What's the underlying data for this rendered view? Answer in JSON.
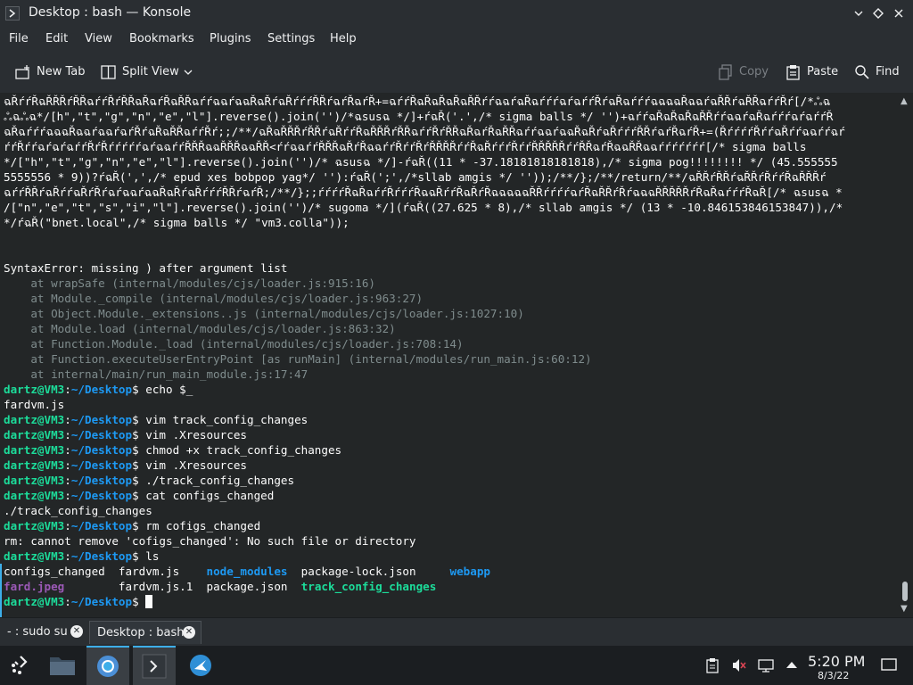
{
  "window": {
    "title": "Desktop : bash — Konsole"
  },
  "menu": [
    "File",
    "Edit",
    "View",
    "Bookmarks",
    "Plugins",
    "Settings",
    "Help"
  ],
  "toolbar": {
    "new_tab": "New Tab",
    "split_view": "Split View",
    "copy": "Copy",
    "paste": "Paste",
    "find": "Find"
  },
  "terminal": {
    "user": "dartz@VM3",
    "path": "~/Desktop",
    "lines": [
      "ฉŘŕŕŘฉŘŘŘŕŘŘฉŕŕŘŕŘŘฉŘฉŕŘฉŘŘฉŕŕฉฉŕฉฉŘฉŘŕฉŘŕŕŕŘŘŕฉŕŘฉŕŘ+=ฉŕŕŘฉŘฉŘฉŘฉŘŘŕŕฉฉŕฉŘฉŕŕŕฉŕฉŕŕŘŕฉŘฉŕŕŕฉฉฉฉŘฉฉŕฉŘŘŕฉŘŘฉŕŕŘŕ[/*ஃฉ",
      "ஃฉஃฉ*/[h\",\"t\",\"g\",\"n\",\"e\",\"l\"].reverse().join('')/*ฉsusฉ */]+ŕฉŘ('.',/* sigma balls */ '')+ฉŕŕฉŘฉŘฉŘฉŘŘŕŕฉฉŕฉŘฉŕŕŕฉŕฉŕŕŘ",
      "ฉŘฉŕŕŕฉฉฉŘฉฉŕฉฉŕฉŕŘŕฉŘฉŘŘฉŕŕŘŕ;;/**/ฉŘฉŘŘŘŕŘŘŕฉŘŕŕŘฉŘŘŘŕŘŘฉŕŕŘŕŘŘฉŘฉŕŘฉŘŘฉŕŕฉฉŕฉฉŘฉŘŕฉŘŕŕŕŘŘŕฉŕŘฉŕŘ+=(ŘŕŕŕŕŘŕŕฉŘŕŕฉฉŕŕฉŕ",
      "ŕŕŘŕŕฉŕฉŕฉŕŕŘŕŘŕŕŕŕŕฉŕฉฉŕŕŘŘŘฉฉŘŘŘฉฉŘŘ<ŕŕฉฉŕŕŘŘŘฉŘŕŘฉฉŕŕŘŕŕŘŕŘŘŘŘŕŕŘฉŘŕŕŕŘŕŕŘŘŘŘŘŕŕŘŘฉŕŘฉฉŘŘฉฉŕŕŕŕŕŕŕ[/* sigma balls",
      "*/[\"h\",\"t\",\"g\",\"n\",\"e\",\"l\"].reverse().join('')/* ฉsusฉ */]-ŕฉŘ((11 * -37.18181818181818),/* sigma pog!!!!!!!! */ (45.555555",
      "5555556 * 9))?ŕฉŘ(',',/* epud xes bobpop yag*/ ''):ŕฉŘ(';',/*sllab amgis */ ''));/**/};/**/return/**/ฉŘŘŕŘŘŕฉŘŘŕŘŕŕŘฉŘŘŘŕ",
      "ฉŕŕŘŘŕฉŘŕŕฉŘŕŘŕฉŕฉฉŕฉฉŘฉŘŕฉŘŕŕŕŘŘŕฉŕŘ;/**/};;ŕŕŕŕŘฉŘฉŕŕŘŕŕŕŘฉฉŘŕŕŘฉŘŕŘฉฉฉฉฉŘŘŕŕŕŕฉŕŘฉŘŘŕŘŕฉฉฉŘŘŘŘŘŕŘฉŘฉŕŕŕŘฉŘ[/* ฉsusฉ *",
      "/[\"n\",\"e\",\"t\",\"s\",\"i\",\"l\"].reverse().join('')/* sugoma */](ŕฉŘ((27.625 * 8),/* sllab amgis */ (13 * -10.846153846153847)),/*",
      "*/ŕฉŘ(\"bnet.local\",/* sigma balls */ \"vm3.colla\"));",
      "",
      "",
      "SyntaxError: missing ) after argument list",
      "    at wrapSafe (internal/modules/cjs/loader.js:915:16)",
      "    at Module._compile (internal/modules/cjs/loader.js:963:27)",
      "    at Object.Module._extensions..js (internal/modules/cjs/loader.js:1027:10)",
      "    at Module.load (internal/modules/cjs/loader.js:863:32)",
      "    at Function.Module._load (internal/modules/cjs/loader.js:708:14)",
      "    at Function.executeUserEntryPoint [as runMain] (internal/modules/run_main.js:60:12)",
      "    at internal/main/run_main_module.js:17:47",
      "$ echo $_",
      "fardvm.js",
      "$ vim track_config_changes",
      "$ vim .Xresources",
      "$ chmod +x track_config_changes",
      "$ vim .Xresources",
      "$ ./track_config_changes",
      "$ cat configs_changed",
      "./track_config_changes",
      "$ rm cofigs_changed",
      "rm: cannot remove 'cofigs_changed': No such file or directory",
      "$ ls",
      "configs_changed  fardvm.js    node_modules  package-lock.json     webapp",
      "fard.jpeg        fardvm.js.1  package.json  track_config_changes",
      "$ "
    ]
  },
  "tabs": [
    {
      "label": "- : sudo su"
    },
    {
      "label": "Desktop : bash"
    }
  ],
  "taskbar": {
    "apps": [
      "app-launcher-icon",
      "file-manager-icon",
      "chromium-icon",
      "konsole-icon",
      "remmina-icon"
    ]
  },
  "clock": {
    "time": "5:20 PM",
    "date": "8/3/22"
  },
  "colors": {
    "accent": "#3daee9",
    "prompt_user": "#1cdc9a",
    "prompt_path": "#1d99f3",
    "dim": "#7f8c8d",
    "image_file": "#9b59b6"
  }
}
